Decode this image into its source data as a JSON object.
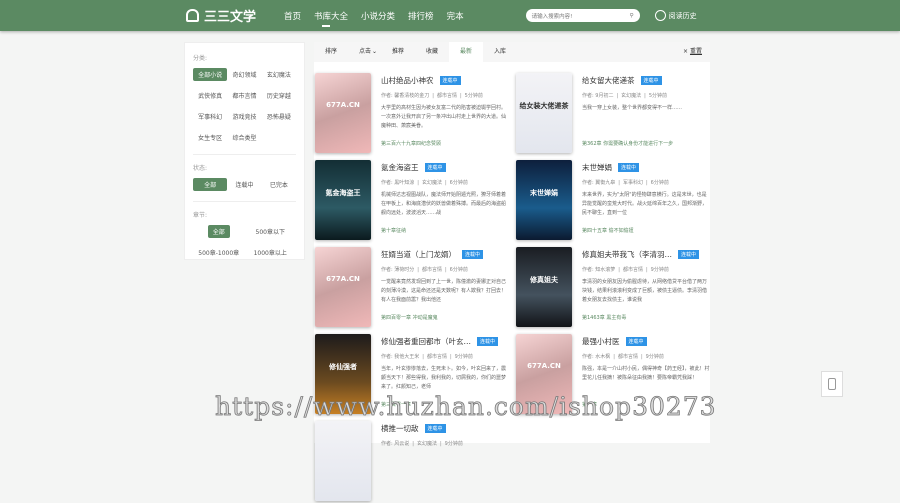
{
  "header": {
    "logo": "三三文学",
    "nav": [
      "首页",
      "书库大全",
      "小说分类",
      "排行榜",
      "完本"
    ],
    "active_nav": 1,
    "search_placeholder": "请输入搜索内容!",
    "history": "阅读历史"
  },
  "sidebar": {
    "category_label": "分类:",
    "categories": [
      "全部小说",
      "奇幻领域",
      "玄幻魔法",
      "武侠修真",
      "都市言情",
      "历史穿越",
      "军事科幻",
      "游戏竞技",
      "恐怖悬疑",
      "女生专区",
      "综合类型"
    ],
    "status_label": "状态:",
    "statuses": [
      "全部",
      "连载中",
      "已完本"
    ],
    "chapter_label": "章节:",
    "chapters": [
      "全部",
      "500章以下",
      "500章-1000章",
      "1000章以上"
    ]
  },
  "sortbar": {
    "items": [
      "排序",
      "点击",
      "推荐",
      "收藏",
      "最新",
      "入库"
    ],
    "active": 4,
    "reset": "重置"
  },
  "books": [
    {
      "title": "山村绝品小神农",
      "status": "连载中",
      "author": "作者: 馨香清枝的金刀",
      "genre": "都市言情",
      "time": "5分钟前",
      "desc": "大学里的高材生因为被女友富二代的陷害被迫辍学回村。一次意外让我开启了另一条冲出山村走上世界的大道。仙魔种田、萧宸美眷。",
      "chapter": "第三百六十九章四纪念赞顾",
      "cover": "c1",
      "cover_text": "677A.CN"
    },
    {
      "title": "给女留大佬递茶",
      "status": "连载中",
      "author": "作者: 9月初二",
      "genre": "玄幻魔法",
      "time": "5分钟前",
      "desc": "当我一穿上女装，整个世界都变得不一样……",
      "chapter": "第362章 你需要确认身份才能进行下一步",
      "cover": "c2",
      "cover_text": "给女装大佬递茶"
    },
    {
      "title": "氪金海盗王",
      "status": "连载中",
      "author": "作者: 黑叶知涼",
      "genre": "玄幻魔法",
      "time": "6分钟前",
      "desc": "机械师达志视图战队，魔法师开始阴遁光照，獠牙师着着在甲板上，和海底潜伏的妖兽做着殊搏。而最后的海盗船舰向远处，波波滔天……战",
      "chapter": "第十章征纳",
      "cover": "c3",
      "cover_text": "氪金海盗王"
    },
    {
      "title": "末世婵娟",
      "status": "连载中",
      "author": "作者: 翼衡九皋",
      "genre": "军事科幻",
      "time": "6分钟前",
      "desc": "末来世界，实为\"太阴\"的怪物肆意横行。这是末世，也是异能觉醒的蛮荒大时代。战火延绵百年之久，国邦渐野，民不聊生，直到一位",
      "chapter": "第四十五章 偷不如偷妞",
      "cover": "c4",
      "cover_text": "末世婵娟"
    },
    {
      "title": "狂婿当道（上门龙婿）",
      "status": "连载中",
      "author": "作者: 薄荷时分",
      "genre": "都市言情",
      "time": "6分钟前",
      "desc": "一觉醒来竟然发现回到了上一世，陈僮澈的妻娜正对自己的刻薄冷漠，这是命还还是天数呢？有人欺我？打回去！有人在我面前嚣？我出他还",
      "chapter": "第四百零一章 冲动是魔鬼",
      "cover": "c1",
      "cover_text": "677A.CN"
    },
    {
      "title": "修真姐夫带我飞（李清羽…",
      "status": "连载中",
      "author": "作者: 知水滚萝",
      "genre": "都市言情",
      "time": "9分钟前",
      "desc": "李清羽的女朋友因为偷腥虐待，从网络借贷平台借了两万块钱，结果利滚滚利变成了巨额，被债主逼债。李清羽借着女朋友去找债主，谁说我",
      "chapter": "第1463章 黑主有毒",
      "cover": "c5",
      "cover_text": "修真姐夫"
    },
    {
      "title": "修仙强者重回都市（叶玄…",
      "status": "连载中",
      "author": "作者: 我他大王米",
      "genre": "都市言情",
      "time": "9分钟前",
      "desc": "当年，叶玄惨惨落去，生死未卜。如今，叶玄回来了，震颤当天下！那些得我，我利我的，切屑我的，你们的噩梦来了。红颜知己，老师",
      "chapter": "第三百零一章",
      "cover": "c6",
      "cover_text": "修仙强者"
    },
    {
      "title": "最强小村医",
      "status": "连载中",
      "author": "作者: 水木枫",
      "genre": "都市言情",
      "time": "9分钟前",
      "desc": "陈强，本是一介山村小民，偶得神奇【药王经】，被此！村里花儿任我摘！被陈朵征由我摘！要陈帝霸凭我踩！",
      "chapter": "第一章",
      "cover": "c1",
      "cover_text": "677A.CN"
    },
    {
      "title": "横推一切敌",
      "status": "连载中",
      "author": "作者: 风云说",
      "genre": "玄幻魔法",
      "time": "9分钟前",
      "desc": "",
      "chapter": "",
      "cover": "c2",
      "cover_text": ""
    }
  ],
  "watermark": "https://www.huzhan.com/ishop30273"
}
